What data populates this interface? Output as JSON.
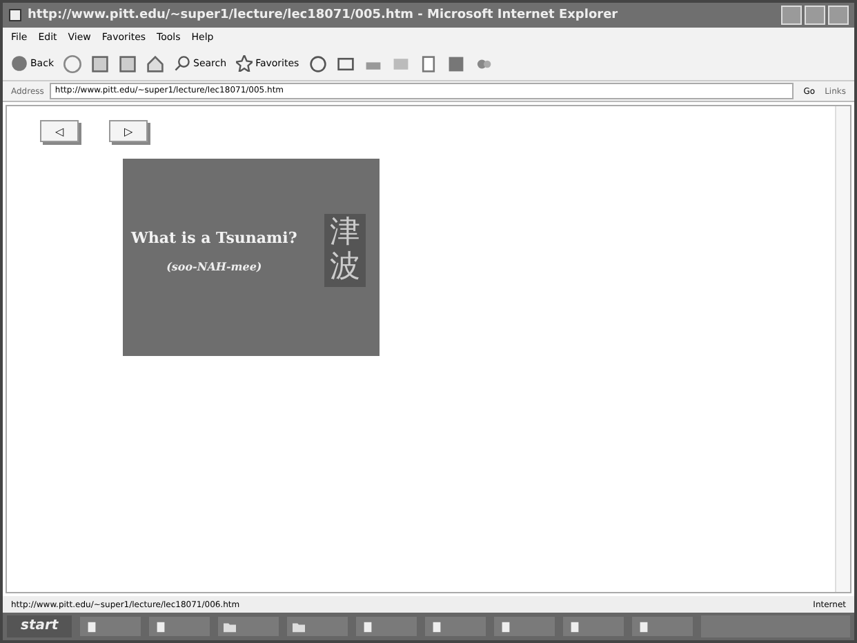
{
  "window": {
    "title": "http://www.pitt.edu/~super1/lecture/lec18071/005.htm - Microsoft Internet Explorer"
  },
  "menu": [
    "File",
    "Edit",
    "View",
    "Favorites",
    "Tools",
    "Help"
  ],
  "toolbar": {
    "back": "Back",
    "search": "Search",
    "favorites": "Favorites"
  },
  "address": {
    "label": "Address",
    "value": "http://www.pitt.edu/~super1/lecture/lec18071/005.htm",
    "go": "Go",
    "links": "Links"
  },
  "nav": [
    "◁",
    "▷"
  ],
  "slide": {
    "title": "What is a Tsunami?",
    "subtitle": "(soo-NAH-mee)",
    "kanji": "津波"
  },
  "status_bar": {
    "url": "http://www.pitt.edu/~super1/lecture/lec18071/006.htm",
    "zone": "Internet"
  },
  "taskbar": {
    "start": "start",
    "buttons": [
      {
        "kind": "page"
      },
      {
        "kind": "page"
      },
      {
        "kind": "folder"
      },
      {
        "kind": "folder"
      },
      {
        "kind": "page"
      },
      {
        "kind": "page"
      },
      {
        "kind": "page"
      },
      {
        "kind": "page"
      },
      {
        "kind": "page"
      }
    ]
  }
}
